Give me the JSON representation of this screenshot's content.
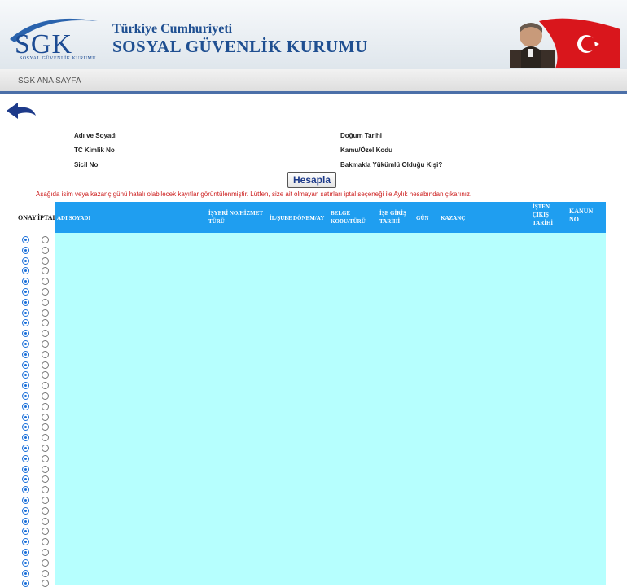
{
  "header": {
    "logo_text": "SGK",
    "logo_subtitle": "SOSYAL GÜVENLİK KURUMU",
    "title": "Türkiye Cumhuriyeti",
    "org_name": "SOSYAL GÜVENLİK KURUMU"
  },
  "nav": {
    "home_label": "SGK ANA SAYFA"
  },
  "icons": {
    "back": "back-arrow-icon"
  },
  "form": {
    "name_label": "Adı ve Soyadı",
    "tc_label": "TC Kimlik No",
    "sicil_label": "Sicil No",
    "birth_label": "Doğum Tarihi",
    "kamu_label": "Kamu/Özel Kodu",
    "dependent_label": "Bakmakla Yükümlü Olduğu Kişi?",
    "calculate_button": "Hesapla"
  },
  "warning": "Aşağıda isim veya kazanç günü hatalı olabilecek kayıtlar görüntülenmiştir. Lütfen, size ait olmayan satırları iptal seçeneği ile Aylık hesabından çıkarınız.",
  "table": {
    "columns": {
      "onay": "ONAY",
      "iptal": "İPTAL",
      "name": "ADI SOYADI",
      "isyeri": "İŞYERİ NO/HİZMET TÜRÜ",
      "sube": "İL/ŞUBE",
      "donem": "DÖNEM/AY",
      "belge": "BELGE KODU/TÜRÜ",
      "giris": "İŞE GİRİŞ TARİHİ",
      "gun": "GÜN",
      "kazanc": "KAZANÇ",
      "cikis": "İŞTEN ÇIKIŞ TARİHİ",
      "kanun": "KANUN NO"
    },
    "row_count": 34
  },
  "colors": {
    "header_blue": "#1f9ef0",
    "row_bg": "#b6fffe",
    "warning": "#cc1c1c",
    "brand": "#1f4f91"
  }
}
